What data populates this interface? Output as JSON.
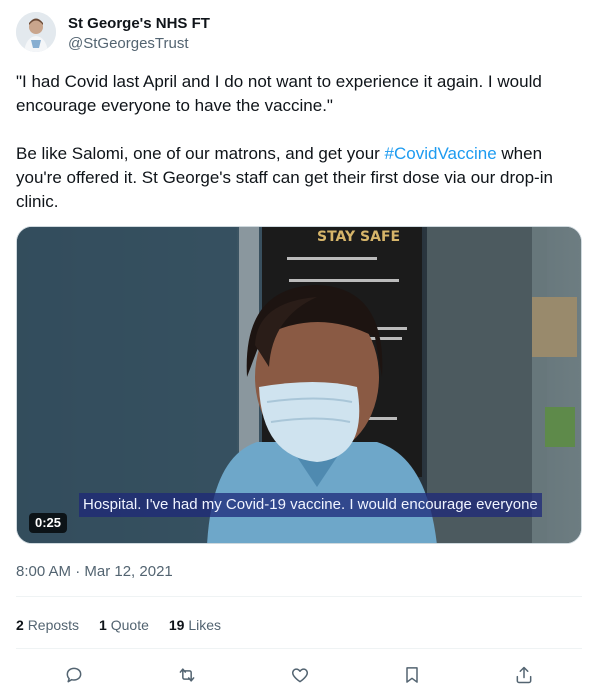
{
  "author": {
    "display_name": "St George's NHS FT",
    "handle": "@StGeorgesTrust"
  },
  "tweet": {
    "para1": "\"I had Covid last April and I do not want to experience it again. I would encourage everyone to have the vaccine.\"",
    "para2_before": "Be like Salomi, one of our matrons, and get your ",
    "hashtag": "#CovidVaccine",
    "para2_after": " when you're offered it. St George's staff can get their first dose via our drop-in clinic."
  },
  "media": {
    "sign_title": "STAY SAFE",
    "caption": "Hospital. I've had my Covid-19 vaccine. I would encourage everyone",
    "duration": "0:25"
  },
  "timestamp": "8:00 AM · Mar 12, 2021",
  "stats": {
    "reposts_count": "2",
    "reposts_label": "Reposts",
    "quotes_count": "1",
    "quotes_label": "Quote",
    "likes_count": "19",
    "likes_label": "Likes"
  },
  "actions": [
    "reply-icon",
    "repost-icon",
    "like-icon",
    "bookmark-icon",
    "share-icon"
  ],
  "colors": {
    "link": "#1d9bf0",
    "secondary_text": "#536471",
    "primary_text": "#0f1419"
  }
}
